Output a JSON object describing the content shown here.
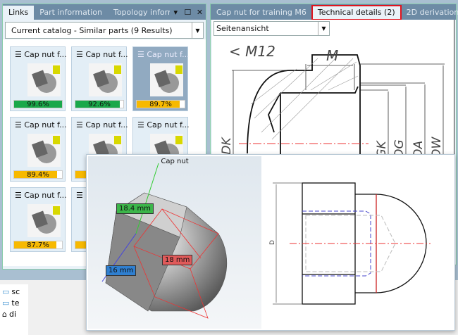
{
  "left_panel": {
    "tabs": [
      "Links",
      "Part information",
      "Topology informati"
    ],
    "catalog_select": "Current catalog - Similar parts (9 Results)",
    "results": [
      {
        "title": "Cap nut f...",
        "score": "99.6%",
        "value": 99.6,
        "color": "#1aa84a"
      },
      {
        "title": "Cap nut f...",
        "score": "92.6%",
        "value": 92.6,
        "color": "#1aa84a"
      },
      {
        "title": "Cap nut f...",
        "score": "89.7%",
        "value": 89.7,
        "color": "#f7b900"
      },
      {
        "title": "Cap nut f...",
        "score": "89.4%",
        "value": 89.4,
        "color": "#f7b900"
      },
      {
        "title": "Cap nut f...",
        "score": "",
        "value": 89,
        "color": "#f7b900"
      },
      {
        "title": "Cap nut f...",
        "score": "",
        "value": 89,
        "color": "#f7b900"
      },
      {
        "title": "Cap nut f...",
        "score": "87.7%",
        "value": 87.7,
        "color": "#f7b900"
      },
      {
        "title": "",
        "score": "",
        "value": 87,
        "color": "#f7b900"
      }
    ]
  },
  "right_panel": {
    "tabs": [
      "Cap nut for training M6",
      "Technical details (2)",
      "2D derivation"
    ],
    "view_select": "Seitenansicht",
    "drawing_labels": {
      "thread": "< M12",
      "m": "M",
      "dk": "ØDK",
      "gk": "ØGK",
      "dg": "ØDG",
      "da": "ØDA",
      "dw": "ØDW"
    }
  },
  "tree": {
    "items": [
      "sc",
      "te",
      "di"
    ]
  },
  "popup": {
    "title": "Cap nut",
    "dim_green": "18.4 mm",
    "dim_red": "18 mm",
    "dim_blue": "16 mm",
    "d_label": "D"
  }
}
